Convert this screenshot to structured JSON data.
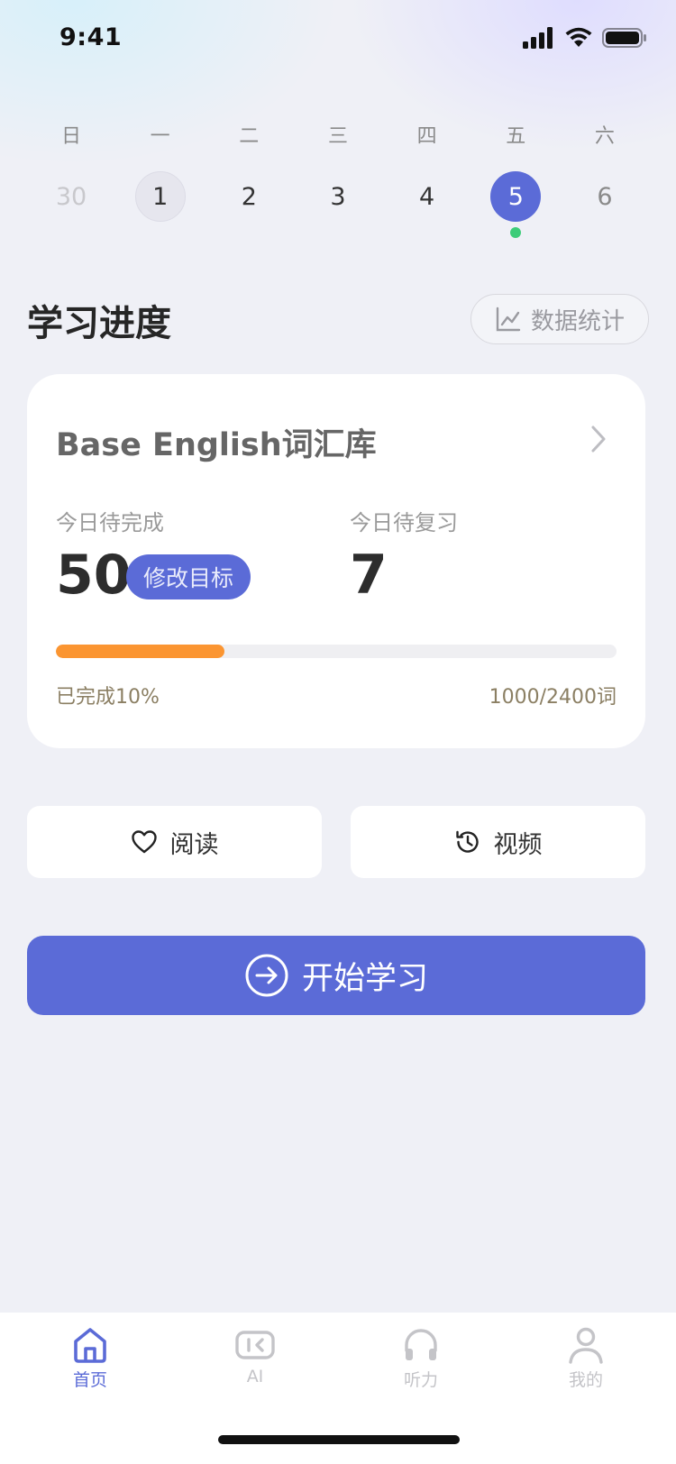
{
  "status_bar": {
    "time": "9:41"
  },
  "calendar": {
    "weekdays": [
      "日",
      "一",
      "二",
      "三",
      "四",
      "五",
      "六"
    ],
    "dates": [
      {
        "day": "30",
        "state": "muted"
      },
      {
        "day": "1",
        "state": "today"
      },
      {
        "day": "2",
        "state": "normal"
      },
      {
        "day": "3",
        "state": "normal"
      },
      {
        "day": "4",
        "state": "normal"
      },
      {
        "day": "5",
        "state": "selected",
        "dot": true
      },
      {
        "day": "6",
        "state": "light"
      }
    ]
  },
  "progress_section": {
    "title": "学习进度",
    "stats_button_label": "数据统计"
  },
  "card": {
    "title": "Base English词汇库",
    "todo_label": "今日待完成",
    "todo_count": "50",
    "edit_goal_label": "修改目标",
    "review_label": "今日待复习",
    "review_count": "7",
    "progress_percent": 30,
    "completed_text": "已完成10%",
    "word_count": "1000/2400词"
  },
  "features": {
    "reading_label": "阅读",
    "video_label": "视频"
  },
  "start_button_label": "开始学习",
  "tabs": [
    {
      "label": "首页",
      "icon": "home-icon",
      "active": true
    },
    {
      "label": "AI",
      "icon": "ai-icon",
      "active": false
    },
    {
      "label": "听力",
      "icon": "headphones-icon",
      "active": false
    },
    {
      "label": "我的",
      "icon": "user-icon",
      "active": false
    }
  ],
  "colors": {
    "accent": "#5b6bd7",
    "progress": "#fb9531",
    "dot": "#3dcc79",
    "background": "#eff0f6"
  }
}
